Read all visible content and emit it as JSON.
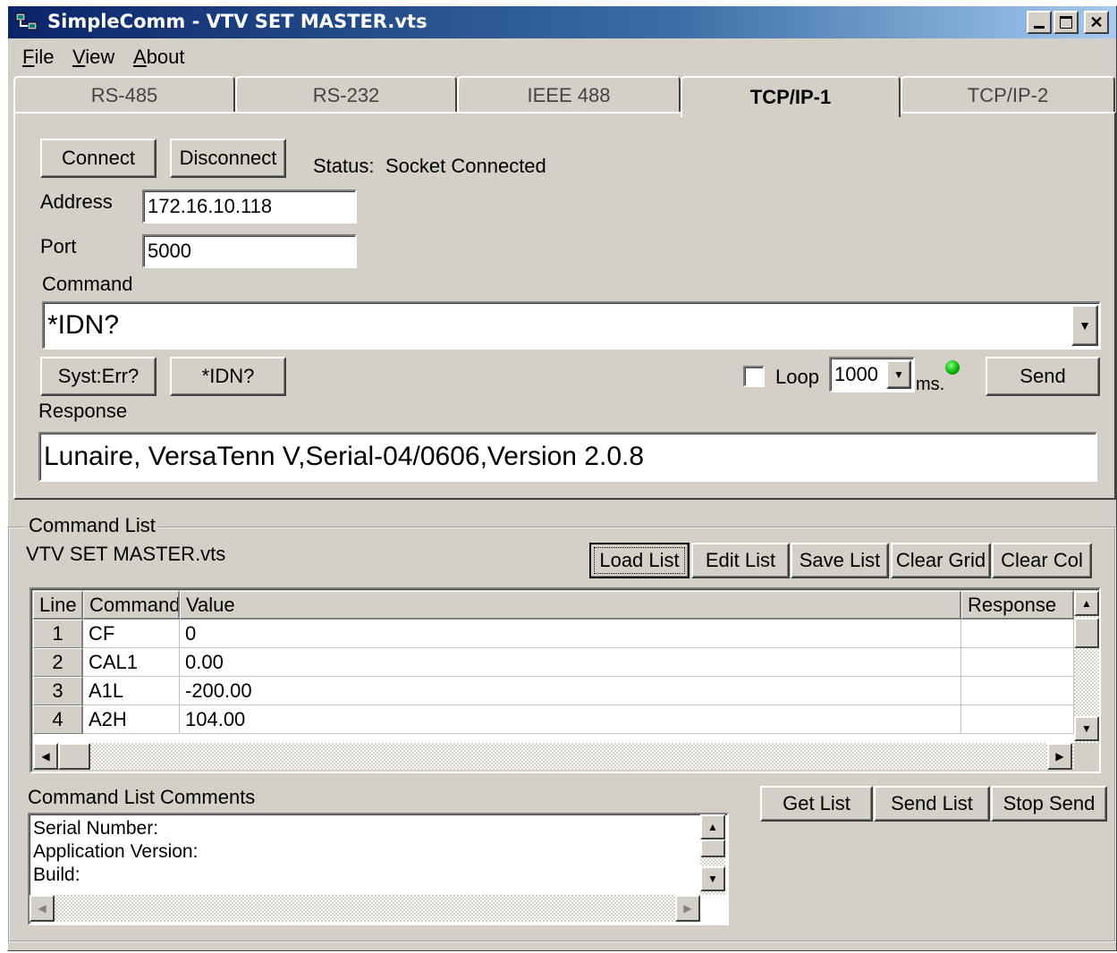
{
  "window": {
    "title": "SimpleComm - VTV SET MASTER.vts"
  },
  "menu": [
    {
      "label": "File",
      "mnemonic": "F",
      "rest": "ile"
    },
    {
      "label": "View",
      "mnemonic": "V",
      "rest": "iew"
    },
    {
      "label": "About",
      "mnemonic": "A",
      "rest": "bout"
    }
  ],
  "tabs": [
    {
      "label": "RS-485",
      "active": false
    },
    {
      "label": "RS-232",
      "active": false
    },
    {
      "label": "IEEE 488",
      "active": false
    },
    {
      "label": "TCP/IP-1",
      "active": true
    },
    {
      "label": "TCP/IP-2",
      "active": false
    }
  ],
  "connection": {
    "connect_label": "Connect",
    "disconnect_label": "Disconnect",
    "status_label": "Status:",
    "status_value": "Socket Connected",
    "address_label": "Address",
    "address_value": "172.16.10.118",
    "port_label": "Port",
    "port_value": "5000"
  },
  "command": {
    "label": "Command",
    "value": "*IDN?",
    "quick1": "Syst:Err?",
    "quick2": "*IDN?",
    "loop_label": "Loop",
    "loop_checked": false,
    "interval_value": "1000",
    "interval_unit": "ms.",
    "send_label": "Send",
    "led_color": "#00c000"
  },
  "response": {
    "label": "Response",
    "value": "Lunaire, VersaTenn V,Serial-04/0606,Version 2.0.8"
  },
  "command_list": {
    "group_label": "Command List",
    "file_name": "VTV SET MASTER.vts",
    "buttons": {
      "load": "Load List",
      "edit": "Edit List",
      "save": "Save List",
      "clear_grid": "Clear Grid",
      "clear_col": "Clear Col"
    },
    "columns": {
      "line": "Line",
      "command": "Command",
      "value": "Value",
      "response": "Response"
    },
    "rows": [
      {
        "line": "1",
        "command": "CF",
        "value": "0",
        "response": ""
      },
      {
        "line": "2",
        "command": "CAL1",
        "value": "0.00",
        "response": ""
      },
      {
        "line": "3",
        "command": "A1L",
        "value": "-200.00",
        "response": ""
      },
      {
        "line": "4",
        "command": "A2H",
        "value": "104.00",
        "response": ""
      }
    ]
  },
  "comments": {
    "label": "Command List Comments",
    "lines": [
      "Serial Number:",
      "Application Version:",
      "Build:"
    ],
    "buttons": {
      "get": "Get List",
      "send": "Send List",
      "stop": "Stop Send"
    }
  }
}
